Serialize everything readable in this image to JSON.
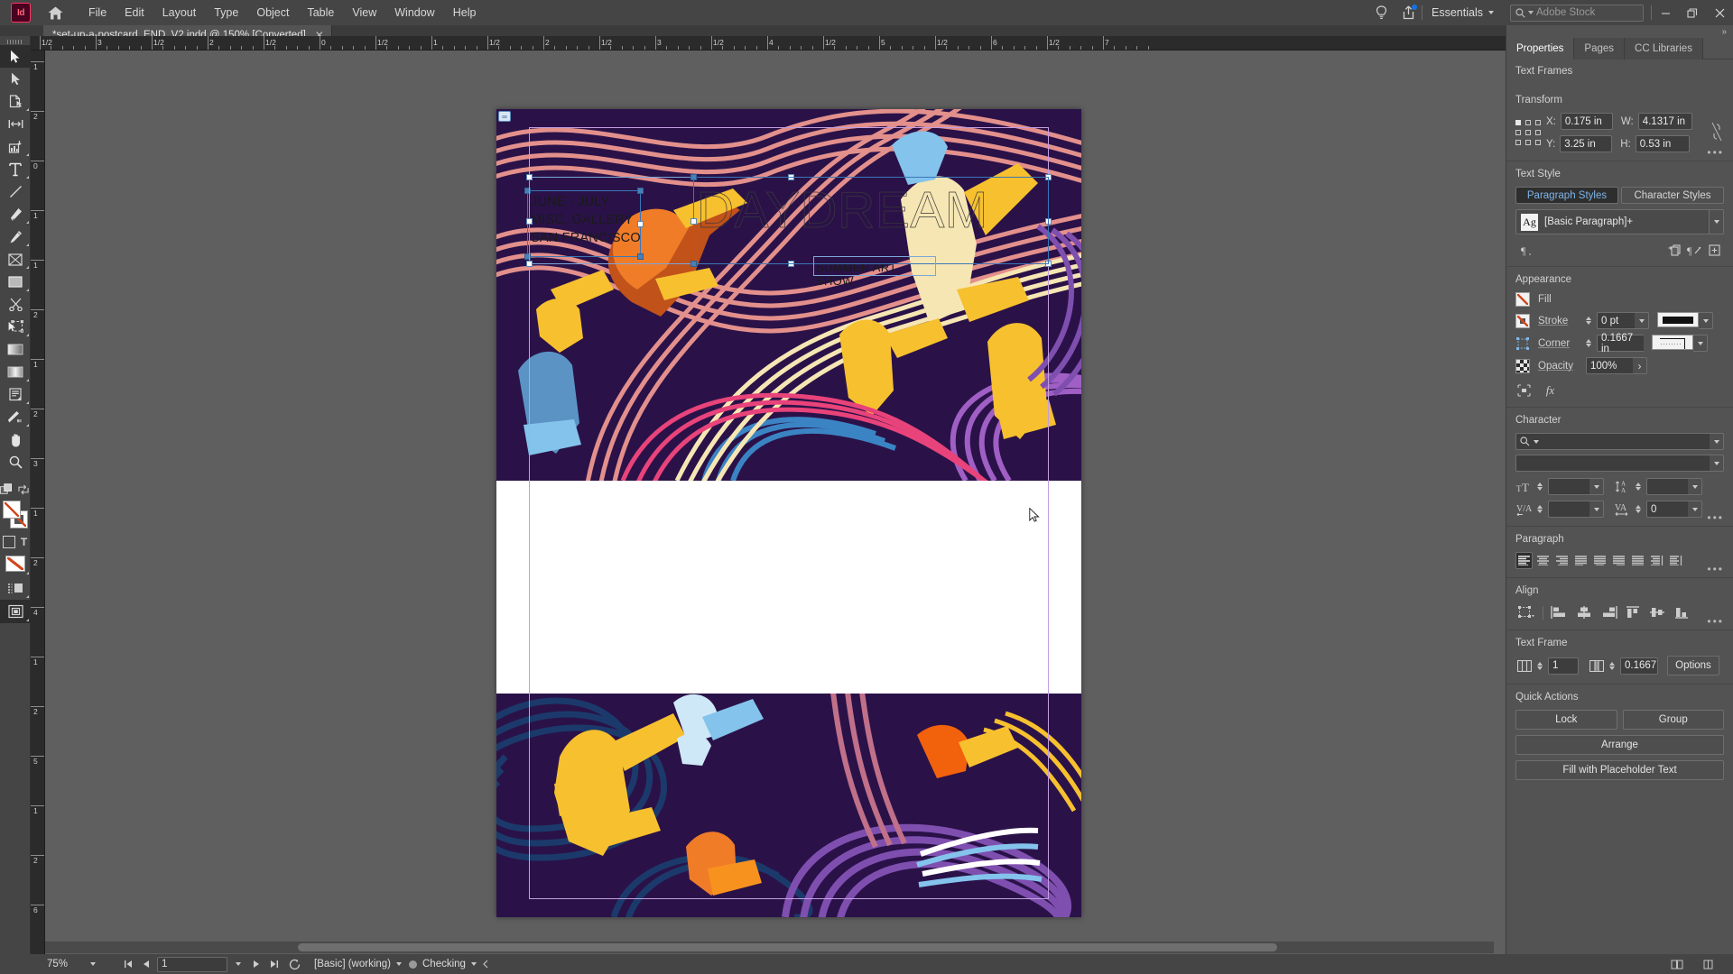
{
  "app": {
    "logo_text": "Id",
    "menus": [
      "File",
      "Edit",
      "Layout",
      "Type",
      "Object",
      "Table",
      "View",
      "Window",
      "Help"
    ],
    "workspace": "Essentials",
    "stock_placeholder": "Adobe Stock",
    "document_tab": "*set-up-a-postcard_END_V2.indd @ 150% [Converted]"
  },
  "toolbar": {
    "tools": [
      {
        "name": "selection-tool",
        "active": true
      },
      {
        "name": "direct-selection-tool",
        "active": false
      },
      {
        "name": "page-tool",
        "active": false
      },
      {
        "name": "gap-tool",
        "active": false
      },
      {
        "name": "content-collector-tool",
        "active": false
      },
      {
        "name": "type-tool",
        "active": false
      },
      {
        "name": "line-tool",
        "active": false
      },
      {
        "name": "pen-tool",
        "active": false
      },
      {
        "name": "pencil-tool",
        "active": false
      },
      {
        "name": "rectangle-frame-tool",
        "active": false
      },
      {
        "name": "rectangle-tool",
        "active": false
      },
      {
        "name": "scissors-tool",
        "active": false
      },
      {
        "name": "free-transform-tool",
        "active": false
      },
      {
        "name": "gradient-swatch-tool",
        "active": false
      },
      {
        "name": "gradient-feather-tool",
        "active": false
      },
      {
        "name": "note-tool",
        "active": false
      },
      {
        "name": "color-theme-tool",
        "active": false
      },
      {
        "name": "hand-tool",
        "active": false
      },
      {
        "name": "zoom-tool",
        "active": false
      }
    ]
  },
  "rulers": {
    "horizontal": [
      "1/2",
      "3",
      "1/2",
      "2",
      "1/2",
      "0",
      "1/2",
      "1",
      "1/2",
      "2",
      "1/2",
      "3",
      "1/2",
      "4",
      "1/2",
      "5",
      "1/2",
      "6",
      "1/2",
      "7"
    ],
    "vertical": [
      "1",
      "2",
      "0",
      "1",
      "1",
      "2",
      "1",
      "2",
      "3",
      "1",
      "2",
      "4",
      "1",
      "2",
      "5",
      "1",
      "2",
      "6"
    ]
  },
  "artboard": {
    "info_lines": [
      "JUNE - JULY",
      "MISC. GALLERY",
      "SAN FRANCISCO"
    ],
    "headline": "DAYDREAM",
    "subhead": "SUMMER ART SHOW",
    "art_colors": {
      "background": "#2a1248",
      "salmon": "#e3908c",
      "orange": "#f07c28",
      "rust": "#c1521a",
      "yellow": "#f7c02f",
      "cream": "#f6e6b4",
      "light_blue": "#84c3ec",
      "steel_blue": "#5b94c4",
      "purple": "#7f4fb0",
      "navy": "#1b3a6b",
      "magenta": "#e8437a"
    }
  },
  "status": {
    "zoom": "75%",
    "page": "1",
    "preflight_profile": "[Basic] (working)",
    "preflight_status": "Checking"
  },
  "properties": {
    "tabs": [
      {
        "label": "Properties",
        "active": true
      },
      {
        "label": "Pages",
        "active": false
      },
      {
        "label": "CC Libraries",
        "active": false
      }
    ],
    "selection_type": "Text Frames",
    "transform": {
      "title": "Transform",
      "x_label": "X:",
      "x_value": "0.175 in",
      "y_label": "Y:",
      "y_value": "3.25 in",
      "w_label": "W:",
      "w_value": "4.1317 in",
      "h_label": "H:",
      "h_value": "0.53 in"
    },
    "text_style": {
      "title": "Text Style",
      "tabs": [
        "Paragraph Styles",
        "Character Styles"
      ],
      "active_tab": "Paragraph Styles",
      "style_glyph": "Ag",
      "style_name": "[Basic Paragraph]+"
    },
    "appearance": {
      "title": "Appearance",
      "fill_label": "Fill",
      "stroke_label": "Stroke",
      "stroke_weight": "0 pt",
      "corner_label": "Corner",
      "corner_value": "0.1667 in",
      "opacity_label": "Opacity",
      "opacity_value": "100%",
      "fx_label": "fx"
    },
    "character": {
      "title": "Character",
      "font_family": "",
      "font_style": "",
      "size": "",
      "leading": "",
      "kerning": "",
      "tracking": "0"
    },
    "paragraph": {
      "title": "Paragraph",
      "active_align": "align-left"
    },
    "align": {
      "title": "Align"
    },
    "text_frame": {
      "title": "Text Frame",
      "columns": "1",
      "gutter": "0.1667",
      "options_label": "Options"
    },
    "quick_actions": {
      "title": "Quick Actions",
      "lock_label": "Lock",
      "group_label": "Group",
      "arrange_label": "Arrange",
      "placeholder_label": "Fill with Placeholder Text"
    }
  }
}
